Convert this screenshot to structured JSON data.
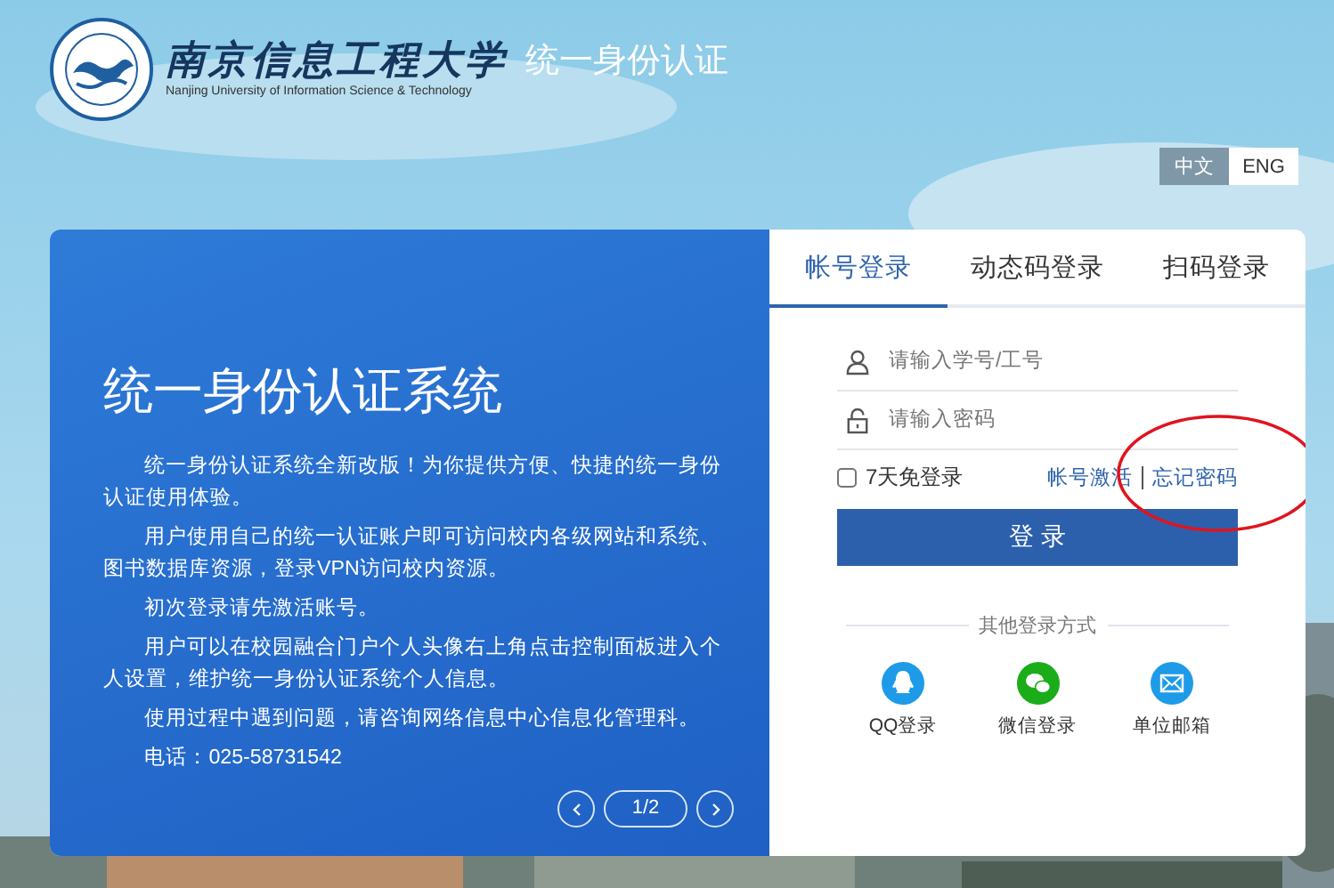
{
  "header": {
    "school_name": "南京信息工程大学",
    "school_name_en": "Nanjing University of Information Science & Technology",
    "system_title": "统一身份认证"
  },
  "language": [
    {
      "label": "中文",
      "selected": true
    },
    {
      "label": "ENG",
      "selected": false
    }
  ],
  "intro": {
    "title": "统一身份认证系统",
    "paragraphs": [
      "统一身份认证系统全新改版！为你提供方便、快捷的统一身份认证使用体验。",
      "用户使用自己的统一认证账户即可访问校内各级网站和系统、图书数据库资源，登录VPN访问校内资源。",
      "初次登录请先激活账号。",
      "用户可以在校园融合门户个人头像右上角点击控制面板进入个人设置，维护统一身份认证系统个人信息。",
      "使用过程中遇到问题，请咨询网络信息中心信息化管理科。",
      "电话：025-58731542"
    ],
    "page": "1/2"
  },
  "login": {
    "tabs": [
      {
        "label": "帐号登录",
        "selected": true
      },
      {
        "label": "动态码登录",
        "selected": false
      },
      {
        "label": "扫码登录",
        "selected": false
      }
    ],
    "fields": [
      {
        "kind": "user",
        "placeholder": "请输入学号/工号"
      },
      {
        "kind": "password",
        "placeholder": "请输入密码"
      }
    ],
    "remember": {
      "label": "7天免登录",
      "checked": false
    },
    "links": [
      "帐号激活",
      "忘记密码"
    ],
    "submit": "登 录",
    "other_title": "其他登录方式",
    "other_methods": [
      {
        "kind": "qq",
        "label": "QQ登录"
      },
      {
        "kind": "wechat",
        "label": "微信登录"
      },
      {
        "kind": "mail",
        "label": "单位邮箱"
      }
    ]
  },
  "annotation_ellipse": true
}
